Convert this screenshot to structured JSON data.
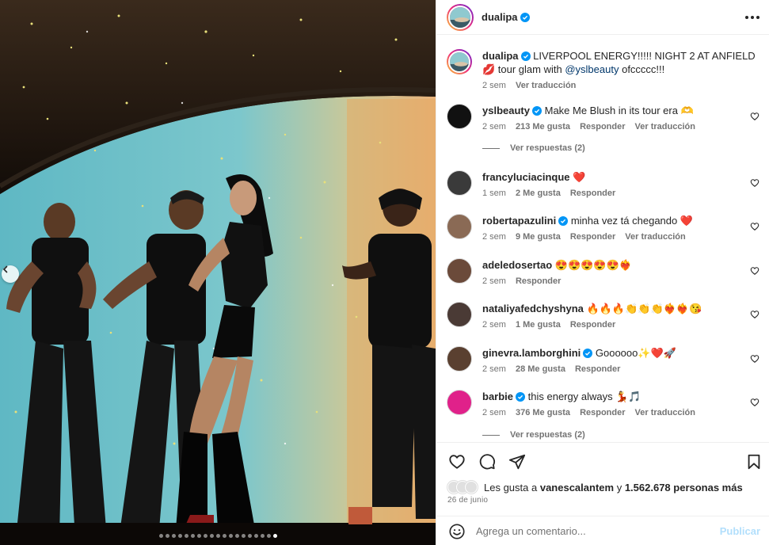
{
  "post": {
    "username": "dualipa",
    "caption_text": "LIVERPOOL ENERGY!!!!! NIGHT 2 AT ANFIELD 💋 tour glam with",
    "caption_mention": "@yslbeauty",
    "caption_end": "ofccccc!!!",
    "time": "2 sem",
    "translate": "Ver traducción",
    "more_icon": "more-horizontal-icon"
  },
  "media": {
    "image_description_icon": "concert-photo",
    "prev_icon": "chevron-left-icon",
    "dot_count": 19,
    "active_dot": 18
  },
  "comments": [
    {
      "user": "yslbeauty",
      "verified": true,
      "text": "Make Me Blush in its tour era 🫶",
      "time": "2 sem",
      "likes": "213 Me gusta",
      "reply": "Responder",
      "translate": "Ver traducción",
      "avatar_color": "#111111"
    },
    {
      "user": "francyluciacinque",
      "verified": false,
      "text": "❤️",
      "time": "1 sem",
      "likes": "2 Me gusta",
      "reply": "Responder",
      "translate": "",
      "avatar_color": "#3a3a3a"
    },
    {
      "user": "robertapazulini",
      "verified": true,
      "text": "minha vez tá chegando ❤️",
      "time": "2 sem",
      "likes": "9 Me gusta",
      "reply": "Responder",
      "translate": "Ver traducción",
      "avatar_color": "#8a6a55"
    },
    {
      "user": "adeledosertao",
      "verified": false,
      "text": "😍😍😍😍😍❤️‍🔥",
      "time": "2 sem",
      "likes": "",
      "reply": "Responder",
      "translate": "",
      "avatar_color": "#6b4a3a"
    },
    {
      "user": "nataliyafedchyshyna",
      "verified": false,
      "text": "🔥🔥🔥👏👏👏❤️‍🔥❤️‍🔥😘",
      "time": "2 sem",
      "likes": "1 Me gusta",
      "reply": "Responder",
      "translate": "",
      "avatar_color": "#4a3a35"
    },
    {
      "user": "ginevra.lamborghini",
      "verified": true,
      "text": "Goooooo✨❤️🚀",
      "time": "2 sem",
      "likes": "28 Me gusta",
      "reply": "Responder",
      "translate": "",
      "avatar_color": "#5a4030"
    },
    {
      "user": "barbie",
      "verified": true,
      "text": "this energy always 💃🎵",
      "time": "2 sem",
      "likes": "376 Me gusta",
      "reply": "Responder",
      "translate": "Ver traducción",
      "avatar_color": "#e0218a"
    }
  ],
  "replies_label_1": "Ver respuestas (2)",
  "replies_label_2": "Ver respuestas (2)",
  "actions": {
    "like_icon": "heart-icon",
    "comment_icon": "comment-icon",
    "share_icon": "share-icon",
    "save_icon": "bookmark-icon",
    "likes_prefix": "Les gusta a",
    "likes_user": "vanescalantem",
    "likes_mid": "y",
    "likes_count": "1.562.678 personas más",
    "date": "26 de junio"
  },
  "add_comment": {
    "emoji_icon": "smiley-icon",
    "placeholder": "Agrega un comentario...",
    "publish": "Publicar"
  },
  "colors": {
    "verified": "#0095f6",
    "publish_disabled": "#b2dffc",
    "secondary_text": "#737373"
  }
}
